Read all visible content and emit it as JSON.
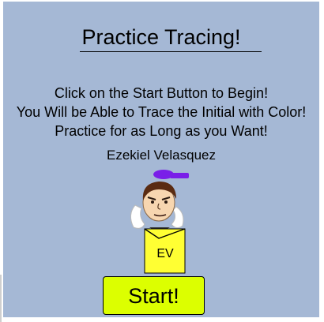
{
  "title": "Practice Tracing!",
  "instructions": [
    "Click on the Start Button to Begin!",
    "You Will be Able to Trace the Initial with Color!",
    "Practice for as Long as you Want!"
  ],
  "author": "Ezekiel Velasquez",
  "avatar": {
    "shirt_initials": "EV",
    "hat_color": "#7a1fe8",
    "shirt_color": "#ffff33"
  },
  "start_button": {
    "label": "Start!",
    "color": "#dcff00"
  },
  "colors": {
    "background": "#a5b8d5"
  }
}
